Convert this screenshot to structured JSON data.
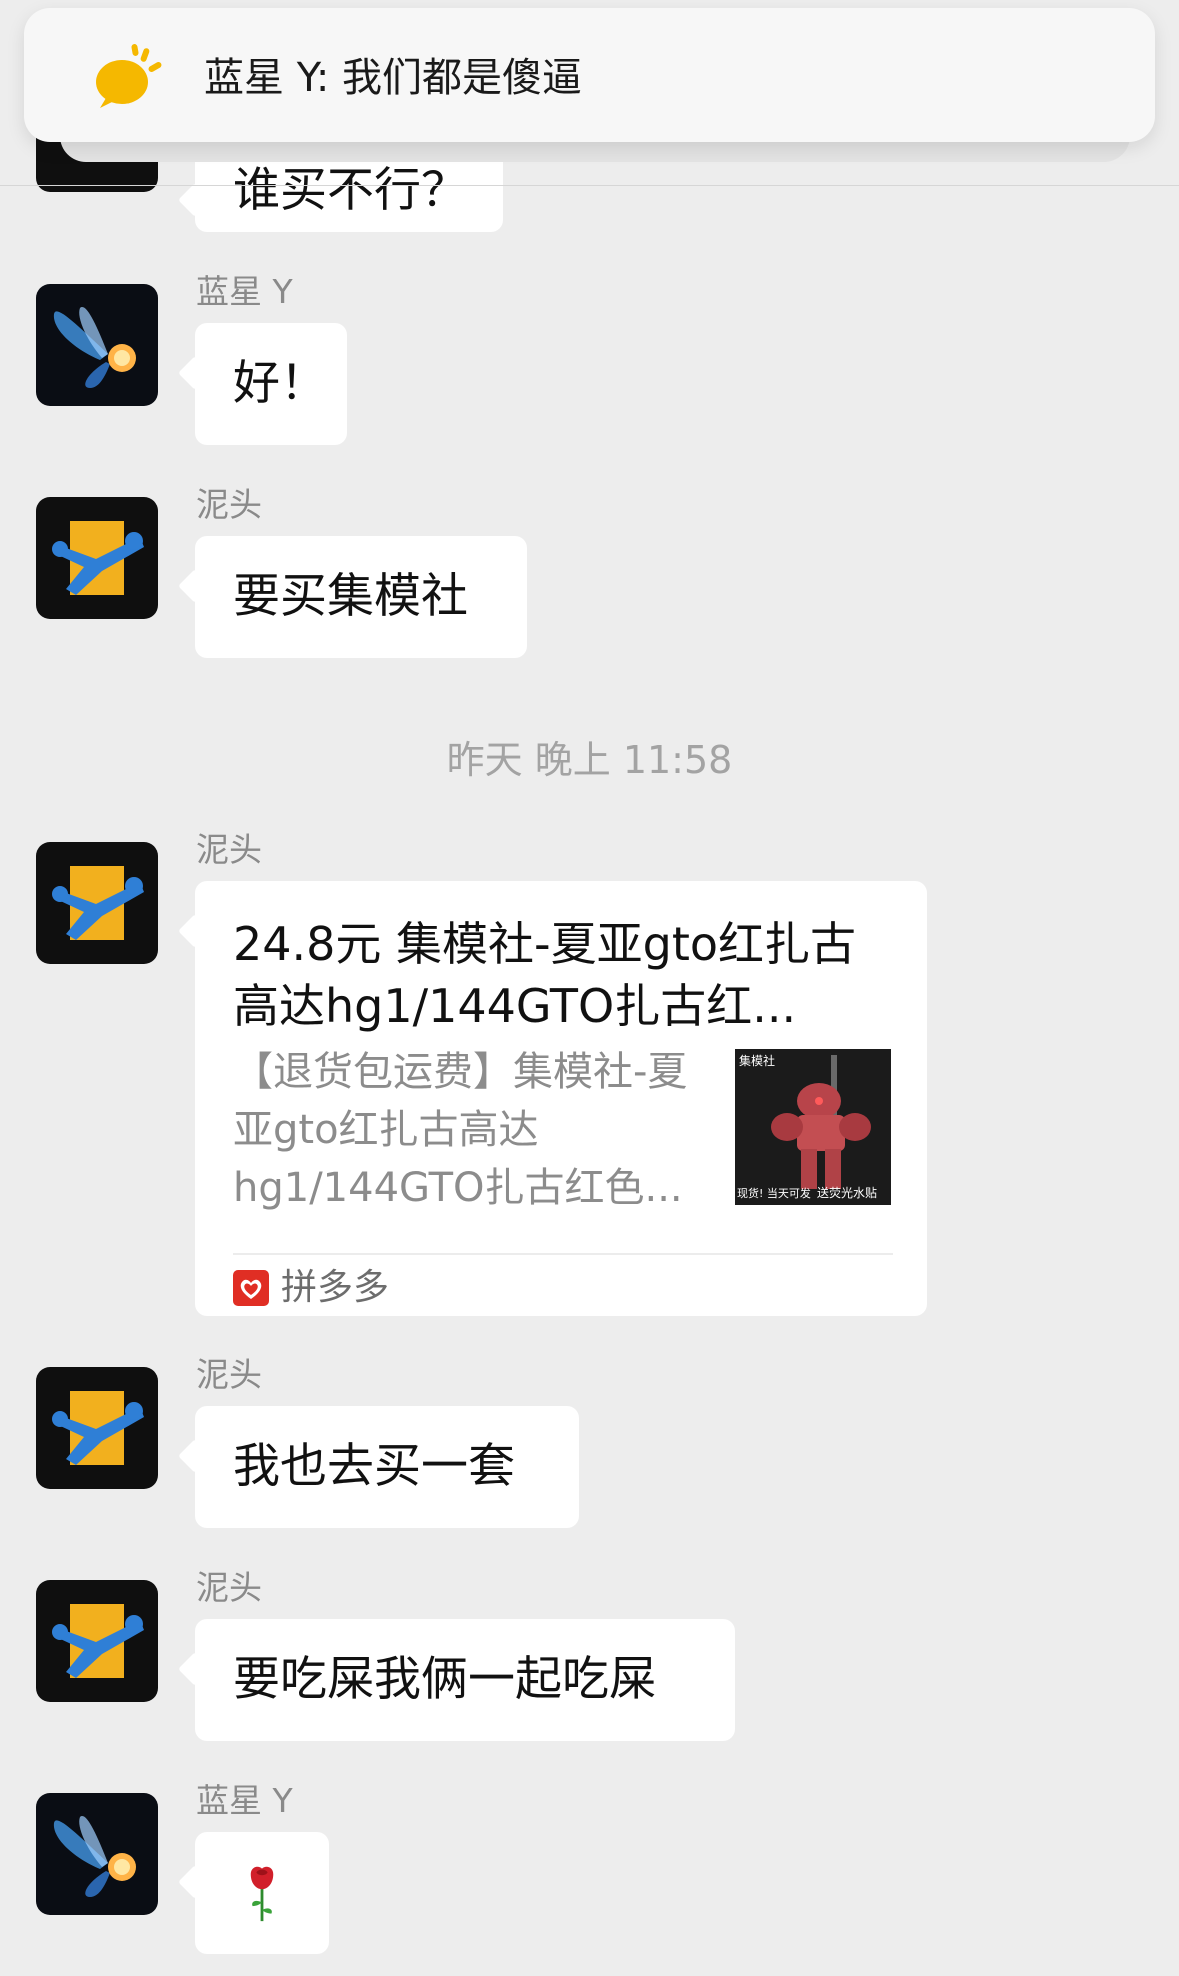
{
  "notification": {
    "sender": "蓝星 Y",
    "text": "蓝星 Y: 我们都是傻逼"
  },
  "cut_off_bubble": {
    "text": "谁买不行？"
  },
  "timestamp": "昨天 晚上 11:58",
  "messages": [
    {
      "sender": "蓝星 Y",
      "text": "好！"
    },
    {
      "sender": "泥头",
      "text": "要买集模社"
    },
    {
      "sender": "泥头",
      "card": {
        "title": "24.8元 集模社-夏亚gto红扎古高达hg1/144GTO扎古红...",
        "description": "【退货包运费】集模社-夏亚gto红扎古高达hg1/144GTO扎古红色...",
        "source": "拼多多",
        "thumbnail_text_top": "集模社",
        "thumbnail_text_bottom_left": "现货! 当天可发",
        "thumbnail_text_bottom_right": "送荧光水贴"
      }
    },
    {
      "sender": "泥头",
      "text": "我也去买一套"
    },
    {
      "sender": "泥头",
      "text": "要吃屎我俩一起吃屎"
    },
    {
      "sender": "蓝星 Y",
      "emoji": "🌹",
      "emoji_name": "rose"
    }
  ],
  "icons": {
    "notification": "sun-chat-icon",
    "avatar_lanxing": "butterfly-avatar",
    "avatar_nitou": "blue-figure-avatar",
    "card_source": "pinduoduo-icon"
  },
  "colors": {
    "background": "#ededed",
    "bubble": "#ffffff",
    "notification_icon": "#f5b800",
    "pdd_red": "#e02e24",
    "avatar_nitou_bg": "#f2b01e",
    "avatar_nitou_figure": "#2f7fd6"
  }
}
